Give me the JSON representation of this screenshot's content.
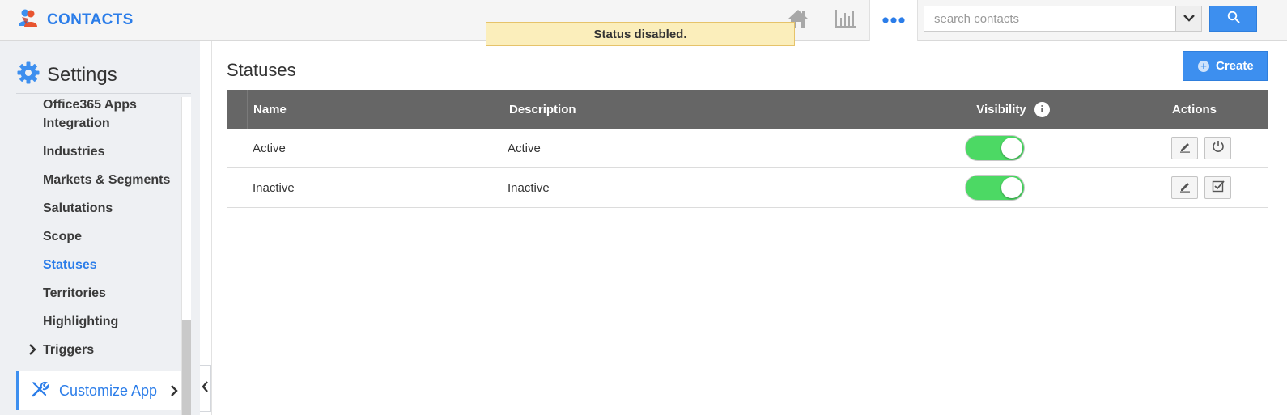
{
  "header": {
    "app_title": "CONTACTS",
    "app_icon": "contacts-people-icon",
    "nav": [
      {
        "name": "home",
        "icon": "home-icon"
      },
      {
        "name": "reports",
        "icon": "bar-chart-icon"
      },
      {
        "name": "more",
        "icon": "more-dots-icon"
      }
    ],
    "search_placeholder": "search contacts",
    "search_value": ""
  },
  "toast": {
    "message": "Status disabled."
  },
  "sidebar": {
    "title": "Settings",
    "title_icon": "gear-icon",
    "items": [
      {
        "label": "Office365 Apps Integration"
      },
      {
        "label": "Industries"
      },
      {
        "label": "Markets & Segments"
      },
      {
        "label": "Salutations"
      },
      {
        "label": "Scope"
      },
      {
        "label": "Statuses",
        "active": true
      },
      {
        "label": "Territories"
      },
      {
        "label": "Highlighting"
      },
      {
        "label": "Triggers",
        "expandable": true
      }
    ],
    "customize": {
      "label": "Customize App",
      "icon": "tools-icon"
    }
  },
  "main": {
    "title": "Statuses",
    "create_label": "Create",
    "table": {
      "columns": {
        "name": "Name",
        "description": "Description",
        "visibility": "Visibility",
        "actions": "Actions"
      },
      "rows": [
        {
          "name": "Active",
          "description": "Active",
          "visible": true,
          "actions": [
            "edit",
            "disable"
          ]
        },
        {
          "name": "Inactive",
          "description": "Inactive",
          "visible": true,
          "actions": [
            "edit",
            "select"
          ]
        }
      ]
    }
  },
  "colors": {
    "accent": "#2b7de9",
    "button_blue": "#3d8fef",
    "toggle_on": "#4cd964",
    "table_header": "#666666",
    "toast_bg": "#fbeebb"
  }
}
